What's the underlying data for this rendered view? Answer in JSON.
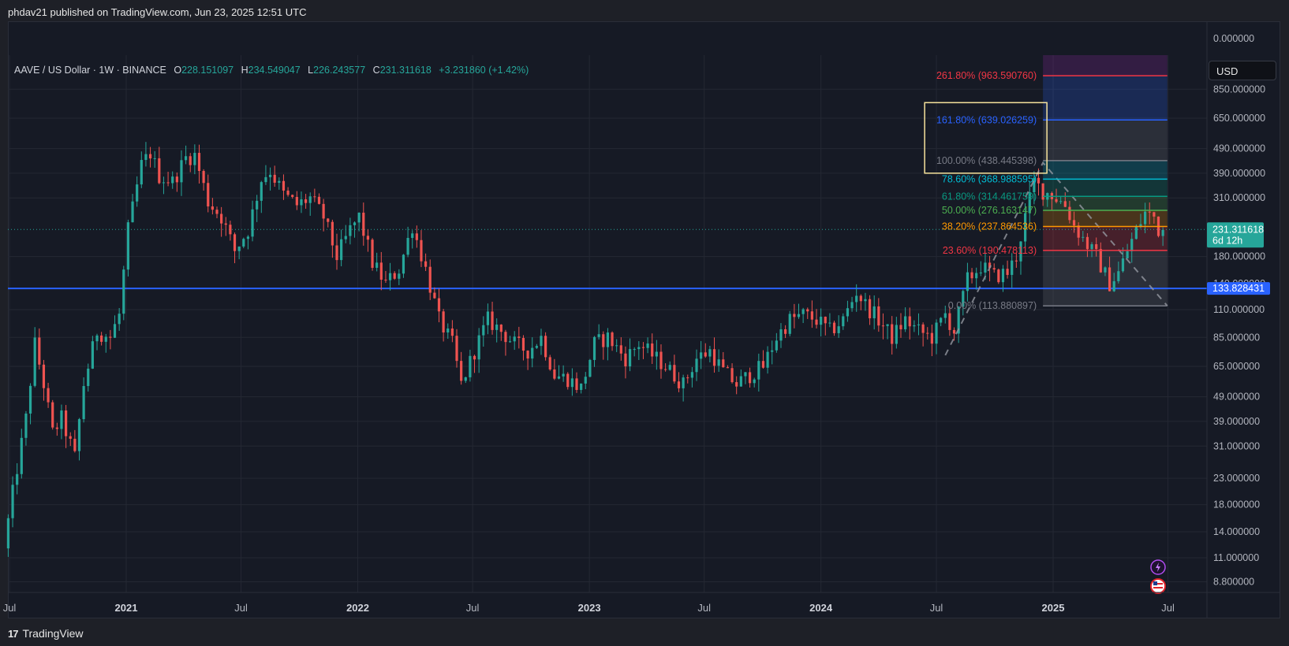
{
  "header": {
    "published": "phdav21 published on TradingView.com, Jun 23, 2025 12:51 UTC"
  },
  "footer": {
    "logo_text": "TradingView",
    "logo_mark": "17"
  },
  "legend": {
    "symbol": "AAVE / US Dollar · 1W · BINANCE",
    "o_label": "O",
    "o_value": "228.151097",
    "h_label": "H",
    "h_value": "234.549047",
    "l_label": "L",
    "l_value": "226.243577",
    "c_label": "C",
    "c_value": "231.311618",
    "change": "+3.231860 (+1.42%)"
  },
  "currency": "USD",
  "price_tags": {
    "last_price": "231.311618",
    "countdown": "6d 12h",
    "hline_price": "133.828431",
    "last_price_value": 231.311618,
    "hline_value": 133.828431
  },
  "colors": {
    "up": "#26a69a",
    "down": "#ef5350",
    "hline": "#2962ff",
    "background": "#161a25"
  },
  "chart_data": {
    "type": "candlestick",
    "symbol": "AAVE / US Dollar",
    "interval": "1W",
    "exchange": "BINANCE",
    "y_scale": "log",
    "y_ticks": [
      {
        "label": "0.000000",
        "value": null
      },
      {
        "label": "850.000000",
        "value": 850
      },
      {
        "label": "650.000000",
        "value": 650
      },
      {
        "label": "490.000000",
        "value": 490
      },
      {
        "label": "390.000000",
        "value": 390
      },
      {
        "label": "310.000000",
        "value": 310
      },
      {
        "label": "180.000000",
        "value": 180
      },
      {
        "label": "140.000000",
        "value": 140
      },
      {
        "label": "110.000000",
        "value": 110
      },
      {
        "label": "85.000000",
        "value": 85
      },
      {
        "label": "65.000000",
        "value": 65
      },
      {
        "label": "49.000000",
        "value": 49
      },
      {
        "label": "39.000000",
        "value": 39
      },
      {
        "label": "31.000000",
        "value": 31
      },
      {
        "label": "23.000000",
        "value": 23
      },
      {
        "label": "18.000000",
        "value": 18
      },
      {
        "label": "14.000000",
        "value": 14
      },
      {
        "label": "11.000000",
        "value": 11
      },
      {
        "label": "8.800000",
        "value": 8.8
      }
    ],
    "x_ticks": [
      {
        "label": "Jul",
        "date": "2020-07-01",
        "bold": false
      },
      {
        "label": "2021",
        "date": "2021-01-01",
        "bold": true
      },
      {
        "label": "Jul",
        "date": "2021-07-01",
        "bold": false
      },
      {
        "label": "2022",
        "date": "2022-01-01",
        "bold": true
      },
      {
        "label": "Jul",
        "date": "2022-07-01",
        "bold": false
      },
      {
        "label": "2023",
        "date": "2023-01-01",
        "bold": true
      },
      {
        "label": "Jul",
        "date": "2023-07-01",
        "bold": false
      },
      {
        "label": "2024",
        "date": "2024-01-01",
        "bold": true
      },
      {
        "label": "Jul",
        "date": "2024-07-01",
        "bold": false
      },
      {
        "label": "2025",
        "date": "2025-01-01",
        "bold": true
      },
      {
        "label": "Jul",
        "date": "2025-07-01",
        "bold": false
      }
    ],
    "price_path": [
      [
        "2020-06-29",
        12
      ],
      [
        "2020-07-13",
        20
      ],
      [
        "2020-08-03",
        40
      ],
      [
        "2020-08-17",
        80
      ],
      [
        "2020-08-31",
        55
      ],
      [
        "2020-09-14",
        35
      ],
      [
        "2020-09-28",
        40
      ],
      [
        "2020-10-19",
        28
      ],
      [
        "2020-11-02",
        55
      ],
      [
        "2020-11-23",
        90
      ],
      [
        "2020-12-14",
        85
      ],
      [
        "2020-12-28",
        105
      ],
      [
        "2021-01-11",
        230
      ],
      [
        "2021-02-01",
        420
      ],
      [
        "2021-02-15",
        470
      ],
      [
        "2021-03-01",
        380
      ],
      [
        "2021-03-22",
        360
      ],
      [
        "2021-04-12",
        450
      ],
      [
        "2021-04-26",
        460
      ],
      [
        "2021-05-17",
        300
      ],
      [
        "2021-06-07",
        260
      ],
      [
        "2021-06-28",
        190
      ],
      [
        "2021-07-19",
        230
      ],
      [
        "2021-08-09",
        370
      ],
      [
        "2021-08-23",
        400
      ],
      [
        "2021-09-13",
        320
      ],
      [
        "2021-10-04",
        290
      ],
      [
        "2021-10-25",
        310
      ],
      [
        "2021-11-15",
        260
      ],
      [
        "2021-12-06",
        180
      ],
      [
        "2021-12-27",
        230
      ],
      [
        "2022-01-10",
        260
      ],
      [
        "2022-01-31",
        170
      ],
      [
        "2022-02-21",
        140
      ],
      [
        "2022-03-14",
        160
      ],
      [
        "2022-04-04",
        240
      ],
      [
        "2022-04-25",
        160
      ],
      [
        "2022-05-16",
        100
      ],
      [
        "2022-06-06",
        80
      ],
      [
        "2022-06-20",
        55
      ],
      [
        "2022-07-11",
        75
      ],
      [
        "2022-08-01",
        100
      ],
      [
        "2022-08-22",
        90
      ],
      [
        "2022-09-12",
        80
      ],
      [
        "2022-10-03",
        75
      ],
      [
        "2022-10-24",
        85
      ],
      [
        "2022-11-14",
        60
      ],
      [
        "2022-12-05",
        58
      ],
      [
        "2022-12-26",
        53
      ],
      [
        "2023-01-16",
        80
      ],
      [
        "2023-02-06",
        85
      ],
      [
        "2023-03-06",
        70
      ],
      [
        "2023-03-27",
        80
      ],
      [
        "2023-04-17",
        72
      ],
      [
        "2023-05-08",
        65
      ],
      [
        "2023-06-05",
        55
      ],
      [
        "2023-06-26",
        70
      ],
      [
        "2023-07-17",
        75
      ],
      [
        "2023-08-07",
        62
      ],
      [
        "2023-08-28",
        55
      ],
      [
        "2023-09-18",
        60
      ],
      [
        "2023-10-09",
        65
      ],
      [
        "2023-10-30",
        85
      ],
      [
        "2023-11-20",
        100
      ],
      [
        "2023-12-11",
        105
      ],
      [
        "2024-01-01",
        100
      ],
      [
        "2024-01-22",
        90
      ],
      [
        "2024-02-12",
        100
      ],
      [
        "2024-03-04",
        130
      ],
      [
        "2024-03-18",
        115
      ],
      [
        "2024-04-08",
        100
      ],
      [
        "2024-04-29",
        85
      ],
      [
        "2024-05-20",
        100
      ],
      [
        "2024-06-10",
        90
      ],
      [
        "2024-07-01",
        85
      ],
      [
        "2024-07-22",
        105
      ],
      [
        "2024-08-05",
        90
      ],
      [
        "2024-08-26",
        145
      ],
      [
        "2024-09-16",
        165
      ],
      [
        "2024-10-07",
        150
      ],
      [
        "2024-10-28",
        155
      ],
      [
        "2024-11-11",
        180
      ],
      [
        "2024-11-25",
        260
      ],
      [
        "2024-12-09",
        360
      ],
      [
        "2024-12-23",
        330
      ],
      [
        "2025-01-06",
        320
      ],
      [
        "2025-01-27",
        290
      ],
      [
        "2025-02-10",
        240
      ],
      [
        "2025-03-03",
        200
      ],
      [
        "2025-03-17",
        180
      ],
      [
        "2025-04-07",
        140
      ],
      [
        "2025-04-21",
        155
      ],
      [
        "2025-05-05",
        190
      ],
      [
        "2025-05-19",
        230
      ],
      [
        "2025-06-02",
        270
      ],
      [
        "2025-06-16",
        260
      ],
      [
        "2025-06-23",
        231.31
      ]
    ],
    "horizontal_line": {
      "price": 133.828431
    },
    "fib_extension": {
      "start_date": "2024-12-16",
      "end_date": "2025-06-30",
      "levels": [
        {
          "ratio": "261.80%",
          "price": 963.59076,
          "label": "261.80% (963.590760)",
          "color": "#f23645"
        },
        {
          "ratio": "161.80%",
          "price": 639.026259,
          "label": "161.80% (639.026259)",
          "color": "#2962ff"
        },
        {
          "ratio": "100.00%",
          "price": 438.445398,
          "label": "100.00% (438.445398)",
          "color": "#787b86"
        },
        {
          "ratio": "78.60%",
          "price": 368.988595,
          "label": "78.60% (368.988595)",
          "color": "#00bcd4"
        },
        {
          "ratio": "61.80%",
          "price": 314.461759,
          "label": "61.80% (314.461759)",
          "color": "#089981"
        },
        {
          "ratio": "50.00%",
          "price": 276.163147,
          "label": "50.00% (276.163147)",
          "color": "#4caf50"
        },
        {
          "ratio": "38.20%",
          "price": 237.864536,
          "label": "38.20% (237.864536)",
          "color": "#ff9800"
        },
        {
          "ratio": "23.60%",
          "price": 190.478113,
          "label": "23.60% (190.478113)",
          "color": "#f23645"
        },
        {
          "ratio": "0.00%",
          "price": 113.880897,
          "label": "0.00% (113.880897)",
          "color": "#787b86"
        }
      ],
      "trend_points": [
        [
          "2024-07-15",
          72
        ],
        [
          "2024-12-16",
          430
        ],
        [
          "2025-06-30",
          113.880897
        ]
      ]
    }
  }
}
